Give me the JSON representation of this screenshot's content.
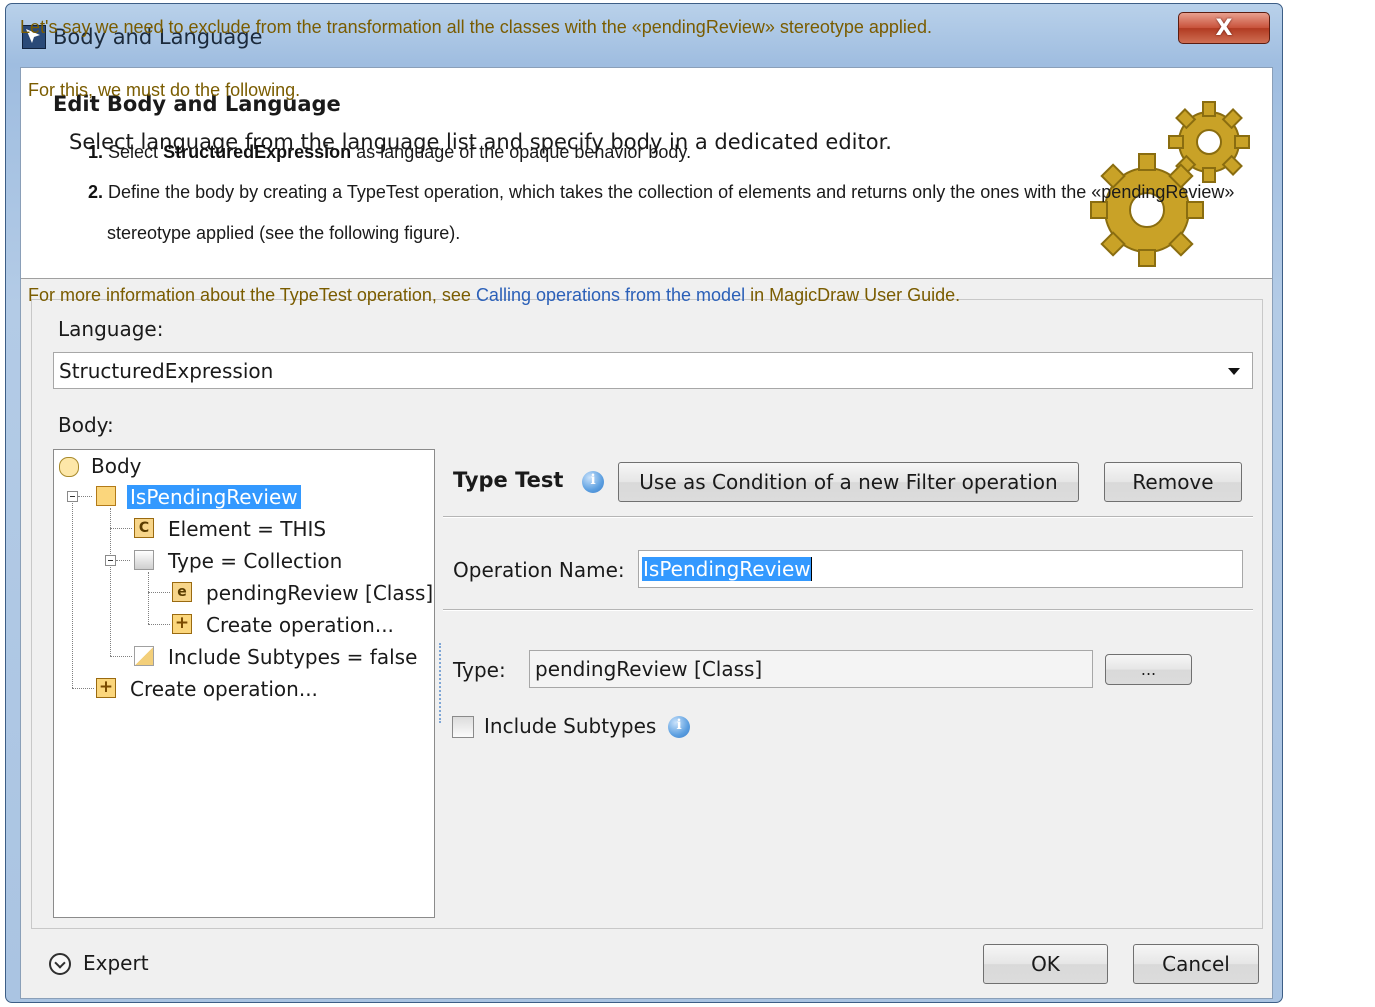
{
  "window": {
    "title": "Body and Language",
    "close_glyph": "X"
  },
  "header": {
    "title": "Edit Body and Language",
    "subtitle": "Select language from the language list and specify body in a dedicated editor.",
    "illustration": "gears-icon"
  },
  "language": {
    "label": "Language:",
    "selected": "StructuredExpression"
  },
  "body": {
    "label": "Body:",
    "tree": [
      {
        "label": "Body",
        "icon": "body-icon"
      },
      {
        "label": "IsPendingReview",
        "icon": "operation-icon",
        "selected": true
      },
      {
        "label": "Element = THIS",
        "icon": "class-c-icon"
      },
      {
        "label": "Type = Collection",
        "icon": "collection-icon"
      },
      {
        "label": "pendingReview [Class]",
        "icon": "class-e-icon"
      },
      {
        "label": "Create operation...",
        "icon": "plus-icon"
      },
      {
        "label": "Include Subtypes = false",
        "icon": "boolean-icon"
      },
      {
        "label": "Create operation...",
        "icon": "plus-icon"
      }
    ]
  },
  "type_test": {
    "title": "Type Test",
    "use_condition_button": "Use as Condition of a new Filter operation",
    "remove_button": "Remove",
    "operation_name_label": "Operation Name:",
    "operation_name_value": "IsPendingReview",
    "type_label": "Type:",
    "type_value": "pendingReview [Class]",
    "browse_button": "...",
    "include_subtypes_label": "Include Subtypes",
    "include_subtypes_checked": false
  },
  "footer": {
    "expert_label": "Expert",
    "ok_button": "OK",
    "cancel_button": "Cancel"
  },
  "doc": {
    "intro": "Let's say we need to exclude from the transformation all the classes with the «pendingReview» stereotype applied.",
    "for_this": "For this, we must do the following.",
    "step1_num": "1.",
    "step1_pre": "Select",
    "step1_bold": "StructuredExpression",
    "step1_post": "as language of the opaque behavior body.",
    "step2_num": "2.",
    "step2_line1": "Define the body by creating a TypeTest operation, which takes the collection of elements and returns only the ones with the «pendingReview»",
    "step2_line2": "stereotype applied (see the following figure).",
    "more_pre": "For more information about the TypeTest operation, see",
    "more_link": "Calling operations from the model",
    "more_post": "in MagicDraw User Guide."
  },
  "colors": {
    "selection": "#3399ff",
    "doc_text": "#7a5c00",
    "link": "#2b60b8",
    "close_button": "#c8523a"
  }
}
